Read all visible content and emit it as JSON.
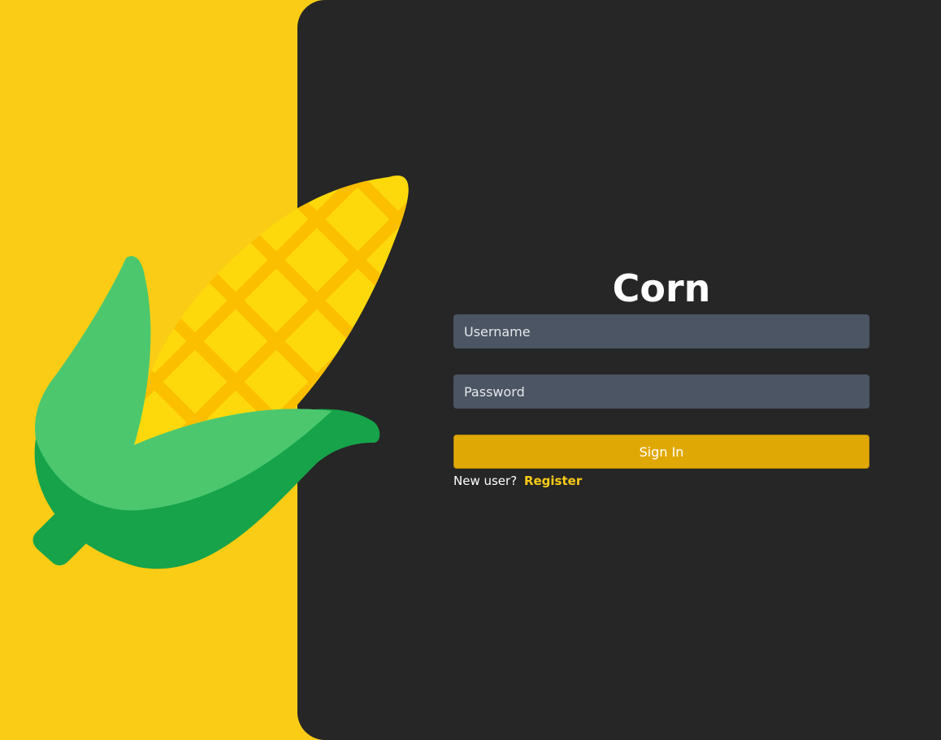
{
  "colors": {
    "background_yellow": "#facc15",
    "panel_dark": "#262626",
    "input_bg": "#4b5563",
    "button_bg": "#e0a805",
    "link_yellow": "#facc15"
  },
  "logo": {
    "icon": "corn-icon"
  },
  "login": {
    "title": "Corn",
    "username_placeholder": "Username",
    "password_placeholder": "Password",
    "sign_in_label": "Sign In",
    "new_user_text": "New user?",
    "register_label": "Register"
  }
}
